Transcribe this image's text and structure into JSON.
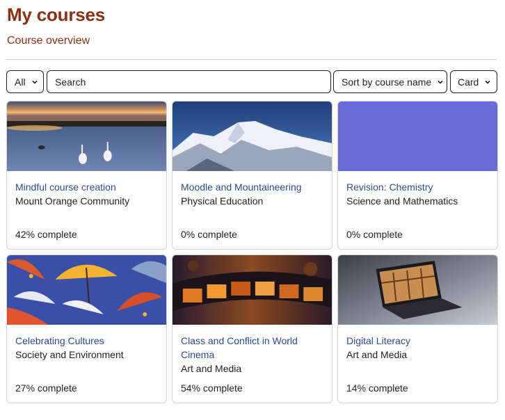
{
  "header": {
    "title": "My courses",
    "subtitle": "Course overview"
  },
  "controls": {
    "filter_label": "All",
    "search_placeholder": "Search",
    "sort_label": "Sort by course name",
    "view_label": "Card"
  },
  "courses": [
    {
      "name": "Mindful course creation",
      "category": "Mount Orange Community",
      "progress": "42% complete",
      "image": "lake-swans"
    },
    {
      "name": "Moodle and Mountaineering",
      "category": "Physical Education",
      "progress": "0% complete",
      "image": "snowy-mountain"
    },
    {
      "name": "Revision: Chemistry",
      "category": "Science and Mathematics",
      "progress": "0% complete",
      "image": "solid-purple"
    },
    {
      "name": "Celebrating Cultures",
      "category": "Society and Environment",
      "progress": "27% complete",
      "image": "umbrellas"
    },
    {
      "name": "Class and Conflict in World Cinema",
      "category": "Art and Media",
      "progress": "54% complete",
      "image": "film-strip"
    },
    {
      "name": "Digital Literacy",
      "category": "Art and Media",
      "progress": "14% complete",
      "image": "tablet-books"
    }
  ],
  "colors": {
    "title": "#8e2f14",
    "link": "#2c4a8c",
    "placeholder_image": "#6a6ad8"
  }
}
